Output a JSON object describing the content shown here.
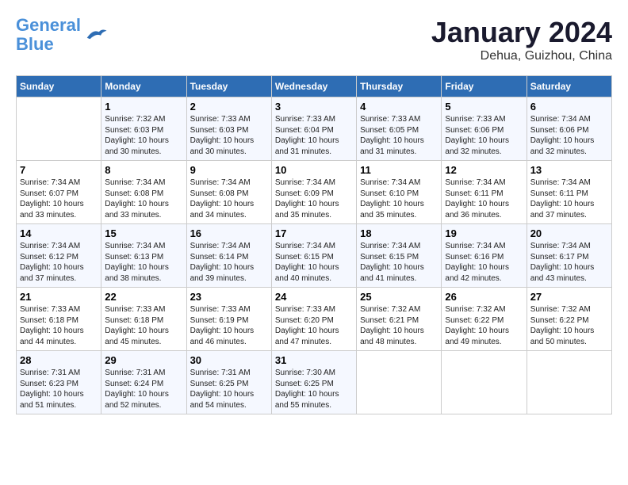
{
  "header": {
    "logo_line1": "General",
    "logo_line2": "Blue",
    "month_title": "January 2024",
    "location": "Dehua, Guizhou, China"
  },
  "days_of_week": [
    "Sunday",
    "Monday",
    "Tuesday",
    "Wednesday",
    "Thursday",
    "Friday",
    "Saturday"
  ],
  "weeks": [
    [
      {
        "day": "",
        "sunrise": "",
        "sunset": "",
        "daylight": ""
      },
      {
        "day": "1",
        "sunrise": "Sunrise: 7:32 AM",
        "sunset": "Sunset: 6:03 PM",
        "daylight": "Daylight: 10 hours and 30 minutes."
      },
      {
        "day": "2",
        "sunrise": "Sunrise: 7:33 AM",
        "sunset": "Sunset: 6:03 PM",
        "daylight": "Daylight: 10 hours and 30 minutes."
      },
      {
        "day": "3",
        "sunrise": "Sunrise: 7:33 AM",
        "sunset": "Sunset: 6:04 PM",
        "daylight": "Daylight: 10 hours and 31 minutes."
      },
      {
        "day": "4",
        "sunrise": "Sunrise: 7:33 AM",
        "sunset": "Sunset: 6:05 PM",
        "daylight": "Daylight: 10 hours and 31 minutes."
      },
      {
        "day": "5",
        "sunrise": "Sunrise: 7:33 AM",
        "sunset": "Sunset: 6:06 PM",
        "daylight": "Daylight: 10 hours and 32 minutes."
      },
      {
        "day": "6",
        "sunrise": "Sunrise: 7:34 AM",
        "sunset": "Sunset: 6:06 PM",
        "daylight": "Daylight: 10 hours and 32 minutes."
      }
    ],
    [
      {
        "day": "7",
        "sunrise": "Sunrise: 7:34 AM",
        "sunset": "Sunset: 6:07 PM",
        "daylight": "Daylight: 10 hours and 33 minutes."
      },
      {
        "day": "8",
        "sunrise": "Sunrise: 7:34 AM",
        "sunset": "Sunset: 6:08 PM",
        "daylight": "Daylight: 10 hours and 33 minutes."
      },
      {
        "day": "9",
        "sunrise": "Sunrise: 7:34 AM",
        "sunset": "Sunset: 6:08 PM",
        "daylight": "Daylight: 10 hours and 34 minutes."
      },
      {
        "day": "10",
        "sunrise": "Sunrise: 7:34 AM",
        "sunset": "Sunset: 6:09 PM",
        "daylight": "Daylight: 10 hours and 35 minutes."
      },
      {
        "day": "11",
        "sunrise": "Sunrise: 7:34 AM",
        "sunset": "Sunset: 6:10 PM",
        "daylight": "Daylight: 10 hours and 35 minutes."
      },
      {
        "day": "12",
        "sunrise": "Sunrise: 7:34 AM",
        "sunset": "Sunset: 6:11 PM",
        "daylight": "Daylight: 10 hours and 36 minutes."
      },
      {
        "day": "13",
        "sunrise": "Sunrise: 7:34 AM",
        "sunset": "Sunset: 6:11 PM",
        "daylight": "Daylight: 10 hours and 37 minutes."
      }
    ],
    [
      {
        "day": "14",
        "sunrise": "Sunrise: 7:34 AM",
        "sunset": "Sunset: 6:12 PM",
        "daylight": "Daylight: 10 hours and 37 minutes."
      },
      {
        "day": "15",
        "sunrise": "Sunrise: 7:34 AM",
        "sunset": "Sunset: 6:13 PM",
        "daylight": "Daylight: 10 hours and 38 minutes."
      },
      {
        "day": "16",
        "sunrise": "Sunrise: 7:34 AM",
        "sunset": "Sunset: 6:14 PM",
        "daylight": "Daylight: 10 hours and 39 minutes."
      },
      {
        "day": "17",
        "sunrise": "Sunrise: 7:34 AM",
        "sunset": "Sunset: 6:15 PM",
        "daylight": "Daylight: 10 hours and 40 minutes."
      },
      {
        "day": "18",
        "sunrise": "Sunrise: 7:34 AM",
        "sunset": "Sunset: 6:15 PM",
        "daylight": "Daylight: 10 hours and 41 minutes."
      },
      {
        "day": "19",
        "sunrise": "Sunrise: 7:34 AM",
        "sunset": "Sunset: 6:16 PM",
        "daylight": "Daylight: 10 hours and 42 minutes."
      },
      {
        "day": "20",
        "sunrise": "Sunrise: 7:34 AM",
        "sunset": "Sunset: 6:17 PM",
        "daylight": "Daylight: 10 hours and 43 minutes."
      }
    ],
    [
      {
        "day": "21",
        "sunrise": "Sunrise: 7:33 AM",
        "sunset": "Sunset: 6:18 PM",
        "daylight": "Daylight: 10 hours and 44 minutes."
      },
      {
        "day": "22",
        "sunrise": "Sunrise: 7:33 AM",
        "sunset": "Sunset: 6:18 PM",
        "daylight": "Daylight: 10 hours and 45 minutes."
      },
      {
        "day": "23",
        "sunrise": "Sunrise: 7:33 AM",
        "sunset": "Sunset: 6:19 PM",
        "daylight": "Daylight: 10 hours and 46 minutes."
      },
      {
        "day": "24",
        "sunrise": "Sunrise: 7:33 AM",
        "sunset": "Sunset: 6:20 PM",
        "daylight": "Daylight: 10 hours and 47 minutes."
      },
      {
        "day": "25",
        "sunrise": "Sunrise: 7:32 AM",
        "sunset": "Sunset: 6:21 PM",
        "daylight": "Daylight: 10 hours and 48 minutes."
      },
      {
        "day": "26",
        "sunrise": "Sunrise: 7:32 AM",
        "sunset": "Sunset: 6:22 PM",
        "daylight": "Daylight: 10 hours and 49 minutes."
      },
      {
        "day": "27",
        "sunrise": "Sunrise: 7:32 AM",
        "sunset": "Sunset: 6:22 PM",
        "daylight": "Daylight: 10 hours and 50 minutes."
      }
    ],
    [
      {
        "day": "28",
        "sunrise": "Sunrise: 7:31 AM",
        "sunset": "Sunset: 6:23 PM",
        "daylight": "Daylight: 10 hours and 51 minutes."
      },
      {
        "day": "29",
        "sunrise": "Sunrise: 7:31 AM",
        "sunset": "Sunset: 6:24 PM",
        "daylight": "Daylight: 10 hours and 52 minutes."
      },
      {
        "day": "30",
        "sunrise": "Sunrise: 7:31 AM",
        "sunset": "Sunset: 6:25 PM",
        "daylight": "Daylight: 10 hours and 54 minutes."
      },
      {
        "day": "31",
        "sunrise": "Sunrise: 7:30 AM",
        "sunset": "Sunset: 6:25 PM",
        "daylight": "Daylight: 10 hours and 55 minutes."
      },
      {
        "day": "",
        "sunrise": "",
        "sunset": "",
        "daylight": ""
      },
      {
        "day": "",
        "sunrise": "",
        "sunset": "",
        "daylight": ""
      },
      {
        "day": "",
        "sunrise": "",
        "sunset": "",
        "daylight": ""
      }
    ]
  ]
}
